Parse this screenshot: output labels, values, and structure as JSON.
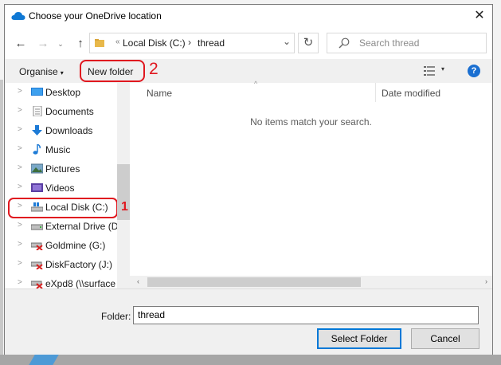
{
  "dialog": {
    "title": "Choose your OneDrive location",
    "close_glyph": "✕",
    "title_icon": "onedrive-cloud-icon"
  },
  "address": {
    "overflow": "«",
    "crumbs": [
      "Local Disk (C:)",
      "thread"
    ],
    "separator": "›",
    "dropdown_glyph": "⌄"
  },
  "nav": {
    "back": "←",
    "forward": "→",
    "recent": "⌄",
    "up": "↑",
    "refresh": "↻"
  },
  "search": {
    "placeholder": "Search thread"
  },
  "toolbar": {
    "organise": "Organise",
    "organise_caret": "▾",
    "new_folder": "New folder",
    "view_caret": "▾",
    "help": "?"
  },
  "annotations": {
    "label1": "1",
    "label2": "2",
    "color": "#e0171f"
  },
  "tree": [
    {
      "label": "Desktop",
      "icon": "desktop-icon"
    },
    {
      "label": "Documents",
      "icon": "documents-icon"
    },
    {
      "label": "Downloads",
      "icon": "downloads-icon"
    },
    {
      "label": "Music",
      "icon": "music-icon"
    },
    {
      "label": "Pictures",
      "icon": "pictures-icon"
    },
    {
      "label": "Videos",
      "icon": "videos-icon"
    },
    {
      "label": "Local Disk (C:)",
      "icon": "windows-drive-icon"
    },
    {
      "label": "External Drive (D",
      "icon": "drive-icon"
    },
    {
      "label": "Goldmine (G:)",
      "icon": "disconnected-drive-icon"
    },
    {
      "label": "DiskFactory (J:)",
      "icon": "disconnected-drive-icon"
    },
    {
      "label": "eXpd8 (\\\\surface",
      "icon": "disconnected-drive-icon"
    }
  ],
  "columns": {
    "name": "Name",
    "date_modified": "Date modified",
    "sort_glyph": "^"
  },
  "empty_message": "No items match your search.",
  "scroll": {
    "left": "‹",
    "right": "›"
  },
  "footer": {
    "folder_label": "Folder:",
    "folder_value": "thread",
    "select_button": "Select Folder",
    "cancel_button": "Cancel"
  },
  "colors": {
    "accent": "#0078d7",
    "help_blue": "#1a6fd1",
    "annotation_red": "#e0171f"
  }
}
